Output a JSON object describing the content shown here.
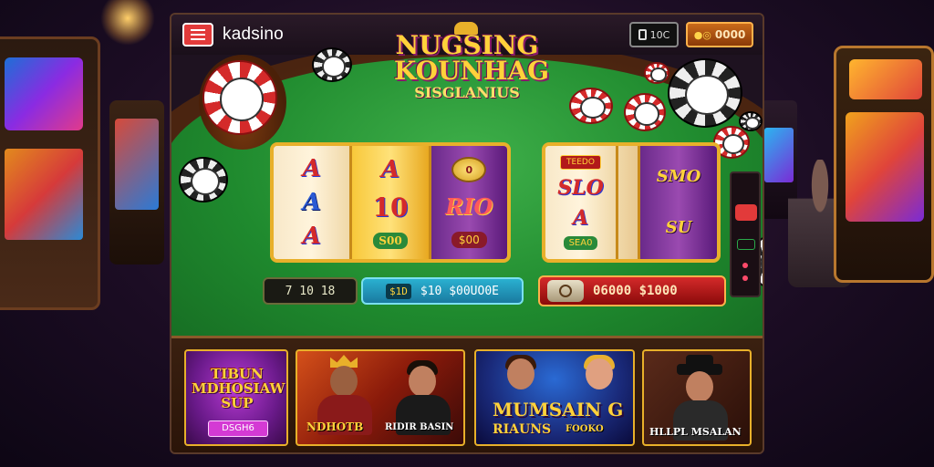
{
  "app": {
    "brand": "kadsino"
  },
  "topbar": {
    "mini_button_label": "10C",
    "balance_label": "0000",
    "balance_icon": "coin-icon"
  },
  "game": {
    "title_line1": "NUGSING",
    "title_line2": "KOUNHAG",
    "title_line3": "SISGLANIUS"
  },
  "slot1": {
    "reel1": [
      "A",
      "A",
      "A"
    ],
    "reel2": [
      "A",
      "10",
      "S00"
    ],
    "reel3": [
      "0",
      "RIO",
      "$00"
    ]
  },
  "slot2": {
    "banner": "TEEDO",
    "reel1": [
      "SLO",
      "A",
      "SEA0"
    ],
    "reel3": [
      "SMO",
      "SU"
    ]
  },
  "bars": {
    "bet": "7 10 18",
    "win_icon": "$1D",
    "win_value": "$10 $00UO0E",
    "credit": "06000 $1000"
  },
  "games": [
    {
      "title": "TIBUN MDHOSIAW SUP",
      "tag": "DSGH6"
    },
    {
      "caption1": "NDHOTB",
      "caption2": "RIDIR BASIN"
    },
    {
      "caption1": "MUMSAIN G",
      "caption2": "RIAUNS",
      "caption3": "FOOKO"
    },
    {
      "caption": "HLLPL MSALAN"
    }
  ],
  "colors": {
    "felt": "#1f8a2e",
    "accent_gold": "#e8b02a",
    "accent_red": "#d42a2a"
  }
}
